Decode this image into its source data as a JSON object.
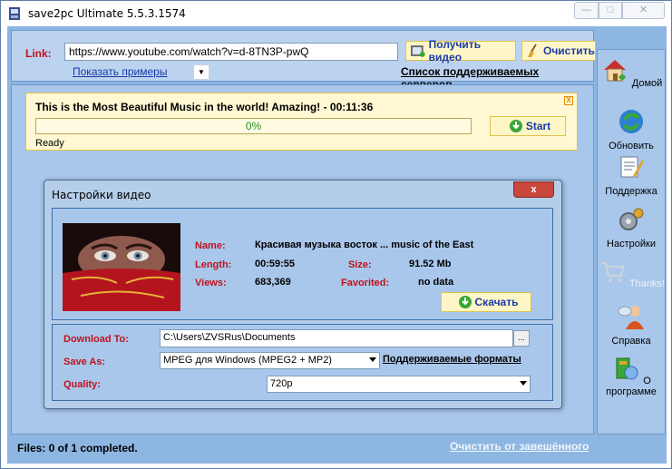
{
  "window": {
    "title": "save2pc Ultimate  5.5.3.1574"
  },
  "link_panel": {
    "label": "Link:",
    "url_value": "https://www.youtube.com/watch?v=d-8TN3P-pwQ",
    "get_video_button": "Получить видео",
    "clear_button": "Очистить",
    "examples_link": "Показать примеры",
    "servers_link": "Список поддерживаемых серверов"
  },
  "task": {
    "title": "This is the Most Beautiful Music in the world! Amazing! - 00:11:36",
    "progress_text": "0%",
    "progress_fraction": 0,
    "status": "Ready",
    "start_button": "Start",
    "close_glyph": "X"
  },
  "footer": {
    "files_status": "Files: 0 of 1 completed.",
    "clear_hung_link": "Очистить от завешённого"
  },
  "sidebar": {
    "items": [
      {
        "label": "Домой",
        "icon": "home-icon"
      },
      {
        "label": "Обновить",
        "icon": "refresh-icon"
      },
      {
        "label": "Поддержка",
        "icon": "support-icon"
      },
      {
        "label": "Настройки",
        "icon": "settings-icon"
      },
      {
        "label": "Thanks!",
        "icon": "cart-icon"
      },
      {
        "label": "Справка",
        "icon": "help-icon"
      },
      {
        "label": "О программе",
        "icon": "about-icon"
      }
    ]
  },
  "dialog": {
    "title": "Настройки видео",
    "close_glyph": "x",
    "info": {
      "name_label": "Name:",
      "name_value": "Красивая музыка восток ... music of the East",
      "length_label": "Length:",
      "length_value": "00:59:55",
      "size_label": "Size:",
      "size_value": "91.52 Mb",
      "views_label": "Views:",
      "views_value": "683,369",
      "favorited_label": "Favorited:",
      "favorited_value": "no data"
    },
    "download_button": "Скачать",
    "download_to_label": "Download To:",
    "download_to_value": "C:\\Users\\ZVSRus\\Documents",
    "browse_button": "...",
    "save_as_label": "Save As:",
    "save_as_value": "MPEG для Windows (MPEG2 + MP2)",
    "formats_link": "Поддерживаемые форматы",
    "quality_label": "Quality:",
    "quality_value": "720p"
  },
  "colors": {
    "client_bg": "#8db6e2",
    "panel_bg": "#a9c7ea",
    "label_red": "#c0121d",
    "button_yellow": "#fff6c8",
    "progress_green": "#2a8f2a"
  }
}
